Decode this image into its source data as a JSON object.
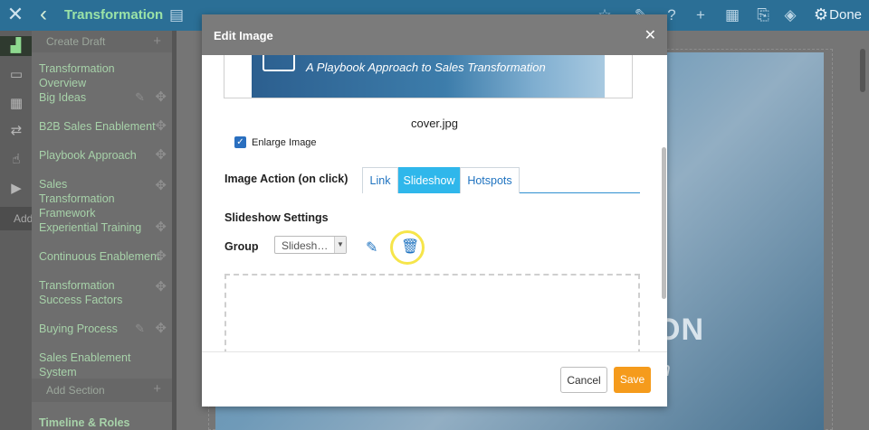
{
  "topbar": {
    "title": "Transformation",
    "done_label": "Done",
    "icons": [
      "close-icon",
      "chevron-left-icon",
      "book-icon",
      "star-icon",
      "pen-icon",
      "help-icon",
      "plus-icon",
      "layout-icon",
      "edit-icon",
      "paint-bucket-icon",
      "gear-icon"
    ]
  },
  "rail": {
    "add_label": "Add",
    "icons": [
      "chart-icon",
      "chat-icon",
      "grid-icon",
      "sync-icon",
      "thumbs-up-icon",
      "video-icon"
    ]
  },
  "sidebar": {
    "create_label": "Create Draft",
    "items": [
      "Transformation Overview",
      "Big Ideas",
      "B2B Sales Enablement",
      "Playbook Approach",
      "Sales Transformation Framework",
      "Experiential Training",
      "Continuous Enablement",
      "Transformation Success Factors",
      "Buying Process",
      "Sales Enablement System"
    ],
    "add_section_label": "Add Section",
    "timeline_label": "Timeline & Roles"
  },
  "canvas": {
    "big_text": "NTATION",
    "sub_text": "ation"
  },
  "modal": {
    "title": "Edit Image",
    "close_label": "✕",
    "thumbnail_text": "A Playbook Approach to Sales Transformation",
    "filename": "cover.jpg",
    "enlarge_label": "Enlarge Image",
    "enlarge_checked": true,
    "action_label": "Image Action (on click)",
    "tabs": [
      "Link",
      "Slideshow",
      "Hotspots"
    ],
    "active_tab": "Slideshow",
    "slideshow_title": "Slideshow Settings",
    "group_label": "Group",
    "group_value": "Slidesh…",
    "cancel_label": "Cancel",
    "save_label": "Save",
    "highlight_color": "#f6e54a",
    "save_color": "#f59b1c",
    "tab_active_color": "#2fb7eb"
  }
}
